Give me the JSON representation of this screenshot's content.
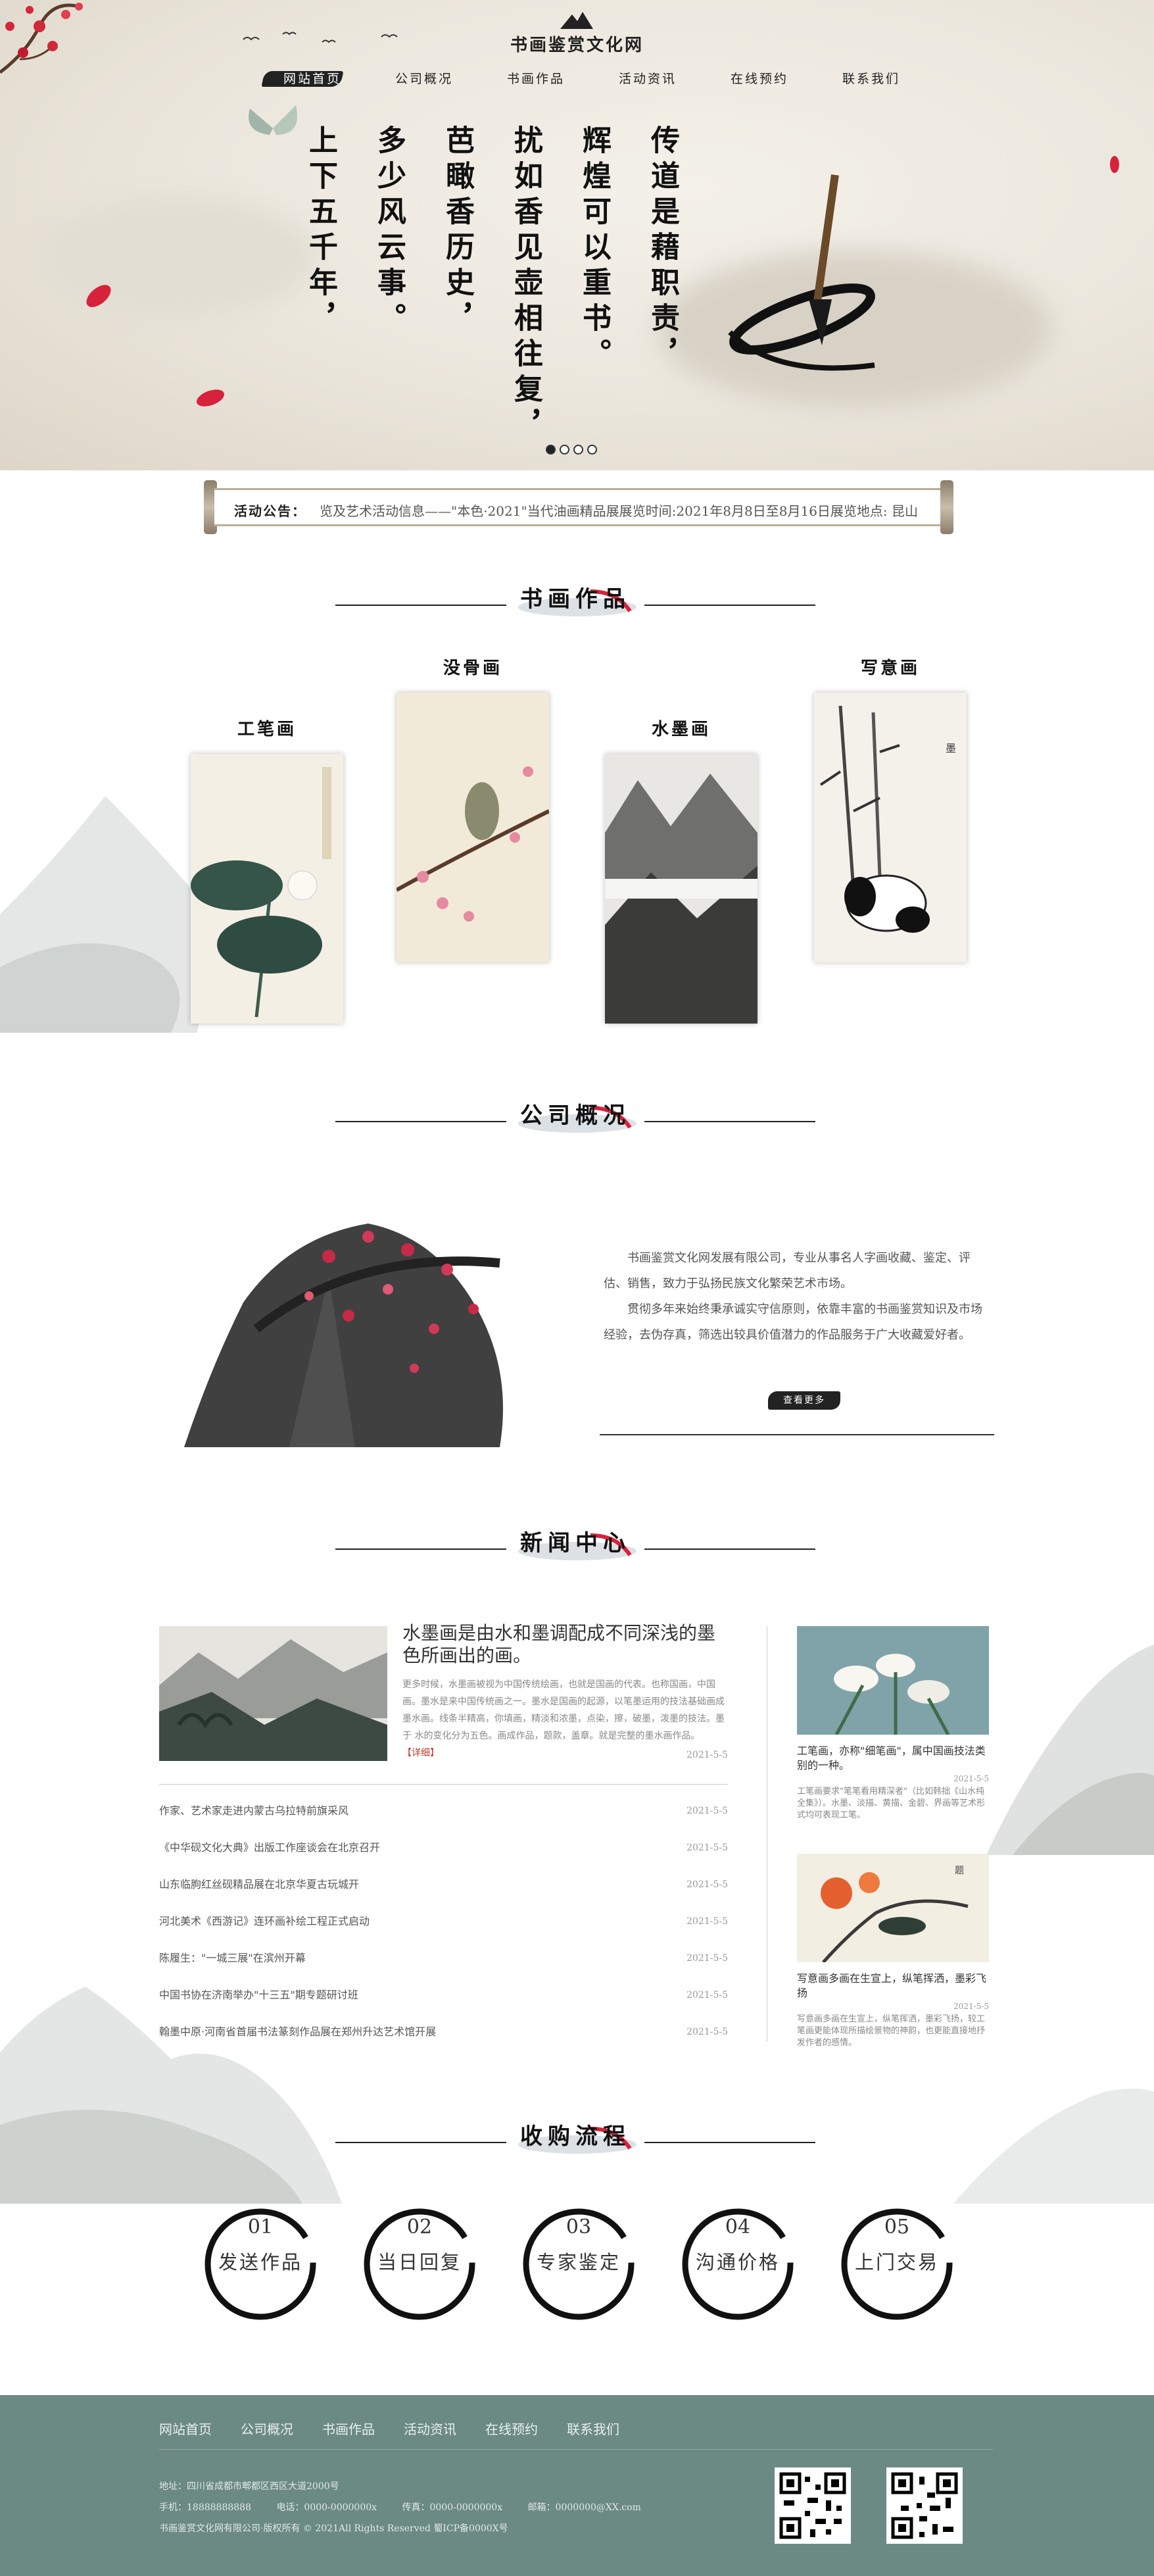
{
  "site": {
    "title": "书画鉴赏文化网"
  },
  "nav": [
    {
      "label": "网站首页"
    },
    {
      "label": "公司概况"
    },
    {
      "label": "书画作品"
    },
    {
      "label": "活动资讯"
    },
    {
      "label": "在线预约"
    },
    {
      "label": "联系我们"
    }
  ],
  "hero": {
    "poem": [
      "传道是藉职责，",
      "辉煌可以重书。",
      "扰如香见壶相往复，",
      "芭瞰香历史，",
      "多少风云事。",
      "上下五千年，"
    ],
    "slides": 4,
    "active_slide": 0
  },
  "notice": {
    "label": "活动公告：",
    "text": "览及艺术活动信息——\"本色·2021\"当代油画精品展展览时间:2021年8月8日至8月16日展览地点: 昆山"
  },
  "sections": {
    "works": "书画作品",
    "about": "公司概况",
    "news": "新闻中心",
    "process": "收购流程"
  },
  "works": [
    {
      "name": "工笔画"
    },
    {
      "name": "没骨画"
    },
    {
      "name": "水墨画"
    },
    {
      "name": "写意画"
    }
  ],
  "about": {
    "p1": "书画鉴赏文化网发展有限公司，专业从事名人字画收藏、鉴定、评估、销售，致力于弘扬民族文化繁荣艺术市场。",
    "p2": "贯彻多年来始终秉承诚实守信原则，依靠丰富的书画鉴赏知识及市场经验，去伪存真，筛选出较具价值潜力的作品服务于广大收藏爱好者。",
    "more": "查看更多"
  },
  "news": {
    "featured": {
      "title": "水墨画是由水和墨调配成不同深浅的墨色所画出的画。",
      "desc": "更多时候，水墨画被视为中国传统绘画，也就是国画的代表。也称国画，中国画。墨水是来中国传统画之一。墨水是国画的起源，以笔墨运用的技法基础画成墨水画。线条半精高，你填画，精淡和浓墨，点染，擦，破墨，泼墨的技法。墨于 水的变化分为五色。画成作品，题款，盖章。就是完整的墨水画作品。",
      "detail": "【详细】",
      "date": "2021-5-5"
    },
    "list": [
      {
        "title": "作家、艺术家走进内蒙古乌拉特前旗采风",
        "date": "2021-5-5"
      },
      {
        "title": "《中华砚文化大典》出版工作座谈会在北京召开",
        "date": "2021-5-5"
      },
      {
        "title": "山东临朐红丝砚精品展在北京华夏古玩城开 ",
        "date": "2021-5-5"
      },
      {
        "title": "河北美术《西游记》连环画补绘工程正式启动",
        "date": "2021-5-5"
      },
      {
        "title": "陈履生：\"一城三展\"在滨州开幕",
        "date": "2021-5-5"
      },
      {
        "title": "中国书协在济南举办\"十三五\"期专题研讨班",
        "date": "2021-5-5"
      },
      {
        "title": "翰墨中原·河南省首届书法篆刻作品展在郑州升达艺术馆开展",
        "date": "2021-5-5"
      }
    ],
    "side": [
      {
        "title": "工笔画，亦称\"细笔画\"，属中国画技法类别的一种。",
        "date": "2021-5-5",
        "desc": "工笔画要求\"笔笔看用精深者\"（比如韩拙《山水纯全集》）。水墨、淡描、黄描、金碧、界画等艺术形式均可表现工笔。"
      },
      {
        "title": "写意画多画在生宣上，纵笔挥洒，墨彩飞扬",
        "date": "2021-5-5",
        "desc": "写意画多画在生宣上，纵笔挥洒，墨彩飞扬，较工笔画更能体现所描绘景物的神韵，也更能直接地抒发作者的感情。"
      }
    ]
  },
  "process": [
    {
      "num": "01",
      "label": "发送作品"
    },
    {
      "num": "02",
      "label": "当日回复"
    },
    {
      "num": "03",
      "label": "专家鉴定"
    },
    {
      "num": "04",
      "label": "沟通价格"
    },
    {
      "num": "05",
      "label": "上门交易"
    }
  ],
  "footer": {
    "nav": [
      "网站首页",
      "公司概况",
      "书画作品",
      "活动资讯",
      "在线预约",
      "联系我们"
    ],
    "address": "地址：四川省成都市郫都区西区大道2000号",
    "phone": "手机：18888888888",
    "tel": "电话：0000-0000000x",
    "fax": "传真：0000-0000000x",
    "email": "邮箱：0000000@XX.com",
    "copyright": "书画鉴赏文化网有限公司·版权所有 © 2021All Rights Reserved 蜀ICP备0000X号"
  },
  "colors": {
    "footer": "#6b8a83",
    "accent_red": "#c0392b",
    "ink": "#222222"
  }
}
